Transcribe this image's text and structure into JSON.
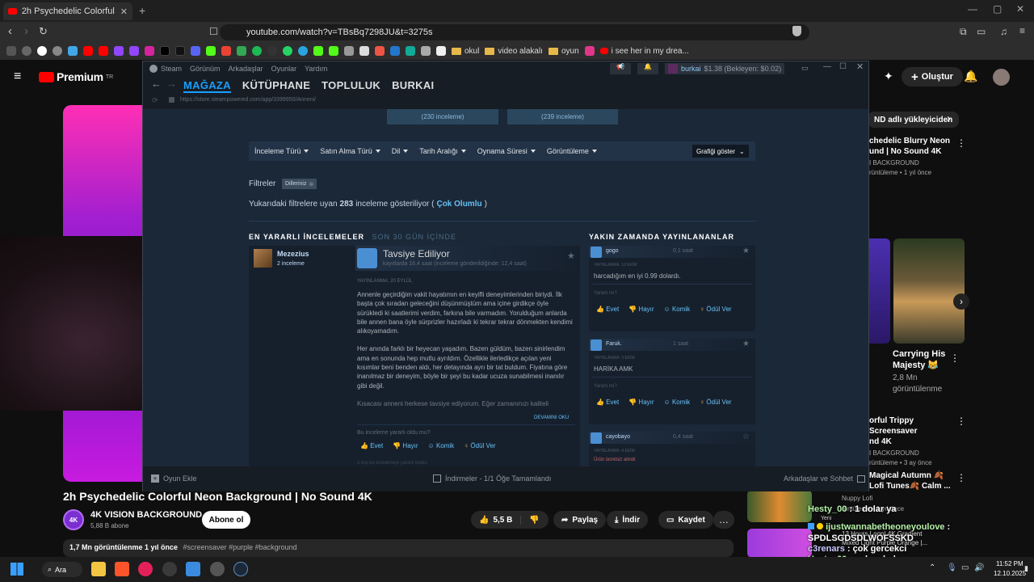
{
  "browser": {
    "tab_title": "2h Psychedelic Colorful Neon Ba",
    "url": "youtube.com/watch?v=TBsBq7298JU&t=3275s",
    "bookmarks": [
      {
        "label": "okul"
      },
      {
        "label": "video alakalı"
      },
      {
        "label": "oyun"
      },
      {
        "label": "i see her in my drea..."
      }
    ]
  },
  "youtube": {
    "logo": "Premium",
    "logo_sup": "TR",
    "create_label": "Oluştur",
    "video_title": "2h Psychedelic Colorful Neon Background | No Sound 4K",
    "channel_name": "4K VISION BACKGROUND",
    "channel_subs": "5,88 B abone",
    "channel_badge": "4K",
    "subscribe_label": "Abone ol",
    "like_count": "5,5 B",
    "share_label": "Paylaş",
    "download_label": "İndir",
    "save_label": "Kaydet",
    "view_line": "1,7 Mn görüntülenme  1 yıl önce",
    "tags": "#screensaver #purple #background",
    "chip": "ND adlı yükleyiciden",
    "sidebar": [
      {
        "title": "chedelic Blurry Neon\nund | No Sound 4K",
        "meta1": "I BACKGROUND",
        "meta2": "rüntüleme • 1 yıl önce"
      },
      {
        "title": "Carrying His\nMajesty 😹",
        "meta1": "2,8 Mn",
        "meta2": "görüntülenme"
      },
      {
        "title": "orful Trippy Screensaver\nnd 4K",
        "meta1": "I BACKGROUND",
        "meta2": "rüntüleme • 3 ay önce"
      },
      {
        "title": "Magical Autumn 🍂\nLofi Tunes🍂 Calm ...",
        "meta1": "Nuppy Lofi",
        "meta2": "rüntüleme • 1 yıl önce"
      },
      {
        "title": "13 Hours Loop| 4K Gradient\nMixed Light Purple Orange |...",
        "meta1": "",
        "meta2": ""
      }
    ]
  },
  "steam": {
    "menu": [
      "Steam",
      "Görünüm",
      "Arkadaşlar",
      "Oyunlar",
      "Yardım"
    ],
    "nav": [
      "MAĞAZA",
      "KÜTÜPHANE",
      "TOPLULUK",
      "BURKAI"
    ],
    "user": "burkai",
    "wallet": "$1.38 (Bekleyen: $0.02)",
    "store_url": "https://store.steampowered.com/app/3399950/Anneni/",
    "top_counts": [
      "(230 inceleme)",
      "(239 inceleme)"
    ],
    "filters": [
      "İnceleme Türü",
      "Satın Alma Türü",
      "Dil",
      "Tarih Aralığı",
      "Oynama Süresi",
      "Görüntüleme"
    ],
    "graph_button": "Grafiği göster",
    "filter_label": "Filtreler",
    "filter_tag": "Dilleriniz",
    "summary_prefix": "Yukarıdaki filtrelere uyan",
    "summary_count": "283",
    "summary_mid": "inceleme gösteriliyor (",
    "summary_rating": "Çok Olumlu",
    "summary_suffix": ")",
    "helpful_heading": "EN YARARLI İNCELEMELER",
    "helpful_sub": "SON 30 GÜN İÇİNDE",
    "recent_heading": "YAKIN ZAMANDA YAYINLANANLAR",
    "main_review": {
      "author": "Mezezius",
      "author_reviews": "2 inceleme",
      "verdict": "Tavsiye Ediliyor",
      "hours": "kayıtlarda 16,4 saat (inceleme gönderildiğinde: 12,4 saat)",
      "posted": "YAYINLANMA: 20 EYLÜL",
      "p1": "Annenle geçirdiğim vakit hayatımın en keyifli deneyimlerinden biriydi. İlk başta çok sıradan geleceğini düşünmüştüm ama içine girdikçe öyle sürükledi ki saatlerimi verdim, farkına bile varmadım. Yorulduğum anlarda bile annen bana öyle sürprizler hazırladı ki tekrar tekrar dönmekten kendimi alıkoyamadım.",
      "p2": "Her anında farklı bir heyecan yaşadım. Bazen güldüm, bazen sinirlendim ama en sonunda hep mutlu ayrıldım. Özellikle ilerledikçe açılan yeni kısımlar beni benden aldı, her detayında ayrı bir tat buldum. Fiyatına göre inanılmaz bir deneyim, böyle bir şeyi bu kadar ucuza sunabilmesi inanılır gibi değil.",
      "p3": "Kısacası anneni herkese tavsiye ediyorum. Eğer zamanınızı kaliteli",
      "read_more": "DEVAMINI OKU",
      "helpful_q": "Bu inceleme yararlı oldu mu?",
      "votes": [
        "Evet",
        "Hayır",
        "Komik",
        "Ödül Ver"
      ],
      "footer": "2 kişi bu incelemeyi yararlı buldu"
    },
    "recent": [
      {
        "author": "gogo",
        "hours": "0,1 saat",
        "posted": "YAYINLANMA: 10 EKİM",
        "text": "harcadığım en iyi 0.99 dolardı.",
        "q": "Yararlı mı?"
      },
      {
        "author": "Faruk.",
        "hours": "1 saat",
        "posted": "YAYINLANMA: 3 EKİM",
        "text": "HARİKA AMK",
        "q": "Yararlı mı?"
      },
      {
        "author": "cayobayo",
        "hours": "0,4 saat",
        "posted": "YAYINLANMA: 4 EKİM",
        "text": "Ürün ücretsiz alındı",
        "q": ""
      }
    ],
    "bottom_add": "Oyun Ekle",
    "bottom_dl": "İndirmeler - 1/1 Öğe Tamamlandı",
    "bottom_friends": "Arkadaşlar ve Sohbet"
  },
  "chat": [
    {
      "user": "Hesty_00",
      "msg": "1 dolar ya"
    },
    {
      "user": "ijustwannabetheoneyoulove",
      "msg": ""
    },
    {
      "user": "SPDLSGDSDLWOFSSKD",
      "msg": ""
    },
    {
      "user": "c3renars",
      "msg": "çok gercekci"
    },
    {
      "user": "Hesty_00",
      "msg": "çok pahalı"
    }
  ],
  "chat_tag": "Yeni",
  "taskbar": {
    "search": "Ara",
    "time": "11:52 PM",
    "date": "12.10.2025"
  },
  "colors": {
    "yt_red": "#ff0000",
    "steam_blue": "#1a9fff",
    "steam_bg": "#1b2838"
  }
}
